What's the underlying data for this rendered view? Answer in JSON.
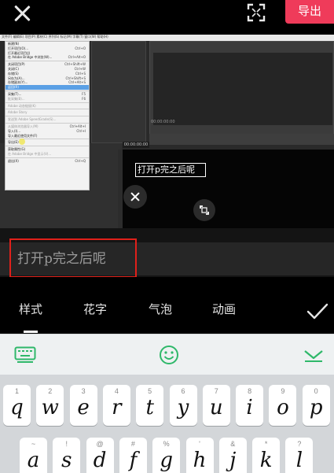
{
  "header": {
    "export_label": "导出"
  },
  "inner_app": {
    "menubar_text": "文件(F)  编辑(E)  项目(P)  素材(C)  序列(S)  标记(M)  字幕(T)  窗口(W)  帮助(H)",
    "menu_items": [
      {
        "label": "新建(N)",
        "shortcut": "",
        "state": "normal"
      },
      {
        "label": "打开项目(O)...",
        "shortcut": "Ctrl+O",
        "state": "normal"
      },
      {
        "label": "打开最近项目(J)",
        "shortcut": "",
        "state": "normal"
      },
      {
        "label": "在 Adobe Bridge 中浏览(W)...",
        "shortcut": "Ctrl+Alt+O",
        "state": "normal"
      },
      {
        "label": "sep"
      },
      {
        "label": "关闭项目(P)",
        "shortcut": "Ctrl+Shift+W",
        "state": "normal"
      },
      {
        "label": "关闭(C)",
        "shortcut": "Ctrl+W",
        "state": "normal"
      },
      {
        "label": "存储(S)",
        "shortcut": "Ctrl+S",
        "state": "normal"
      },
      {
        "label": "另存为(A)...",
        "shortcut": "Ctrl+Shift+S",
        "state": "normal"
      },
      {
        "label": "存储副本(Y)...",
        "shortcut": "Ctrl+Alt+S",
        "state": "normal"
      },
      {
        "label": "返回(R)",
        "shortcut": "",
        "state": "highlight"
      },
      {
        "label": "sep"
      },
      {
        "label": "采集(T)...",
        "shortcut": "F5",
        "state": "normal"
      },
      {
        "label": "批采集(B)...",
        "shortcut": "F6",
        "state": "dim"
      },
      {
        "label": "sep"
      },
      {
        "label": "Adobe 动态链接(K)",
        "shortcut": "",
        "state": "dim"
      },
      {
        "label": "sep"
      },
      {
        "label": "Adobe Story",
        "shortcut": "",
        "state": "dim"
      },
      {
        "label": "sep"
      },
      {
        "label": "发送到 Adobe SpeedGrade(S)...",
        "shortcut": "",
        "state": "dim"
      },
      {
        "label": "sep"
      },
      {
        "label": "从媒体浏览器导入(M)",
        "shortcut": "Ctrl+Alt+I",
        "state": "dim"
      },
      {
        "label": "导入(I)...",
        "shortcut": "Ctrl+I",
        "state": "normal"
      },
      {
        "label": "导入最近使用文件(F)",
        "shortcut": "",
        "state": "normal"
      },
      {
        "label": "sep"
      },
      {
        "label": "导出(E)",
        "shortcut": "",
        "state": "normal"
      },
      {
        "label": "sep"
      },
      {
        "label": "获取属性(G)",
        "shortcut": "",
        "state": "normal"
      },
      {
        "label": "在 Adobe Bridge 中显示(V)...",
        "shortcut": "",
        "state": "dim"
      },
      {
        "label": "sep"
      },
      {
        "label": "退出(X)",
        "shortcut": "Ctrl+Q",
        "state": "normal"
      }
    ],
    "timecode": "00:00:00:00",
    "timecode_small": "00:00:00:00"
  },
  "overlay": {
    "caption_text": "打开p完之后呢"
  },
  "editor": {
    "input_value": "打开p完之后呢"
  },
  "style_tabs": [
    {
      "label": "样式",
      "selected": true
    },
    {
      "label": "花字",
      "selected": false
    },
    {
      "label": "气泡",
      "selected": false
    },
    {
      "label": "动画",
      "selected": false
    }
  ],
  "keyboard": {
    "row1": [
      {
        "hint": "1",
        "char": "q"
      },
      {
        "hint": "2",
        "char": "w"
      },
      {
        "hint": "3",
        "char": "e"
      },
      {
        "hint": "4",
        "char": "r"
      },
      {
        "hint": "5",
        "char": "t"
      },
      {
        "hint": "6",
        "char": "y"
      },
      {
        "hint": "7",
        "char": "u"
      },
      {
        "hint": "8",
        "char": "i"
      },
      {
        "hint": "9",
        "char": "o"
      },
      {
        "hint": "0",
        "char": "p"
      }
    ],
    "row2": [
      {
        "hint": "~",
        "char": "a"
      },
      {
        "hint": "!",
        "char": "s"
      },
      {
        "hint": "@",
        "char": "d"
      },
      {
        "hint": "#",
        "char": "f"
      },
      {
        "hint": "%",
        "char": "g"
      },
      {
        "hint": "'",
        "char": "h"
      },
      {
        "hint": "&",
        "char": "j"
      },
      {
        "hint": "*",
        "char": "k"
      },
      {
        "hint": "?",
        "char": "l"
      }
    ]
  },
  "colors": {
    "export_accent": "#ef3b5a",
    "keyboard_toolbar_icon": "#2fb86a",
    "highlight_box": "#e0201a"
  },
  "icons": {
    "close": "close-icon",
    "fullscreen": "fullscreen-icon",
    "keyboard": "keyboard-icon",
    "emoji": "emoji-icon",
    "collapse": "collapse-keyboard-icon",
    "confirm": "checkmark-icon"
  }
}
